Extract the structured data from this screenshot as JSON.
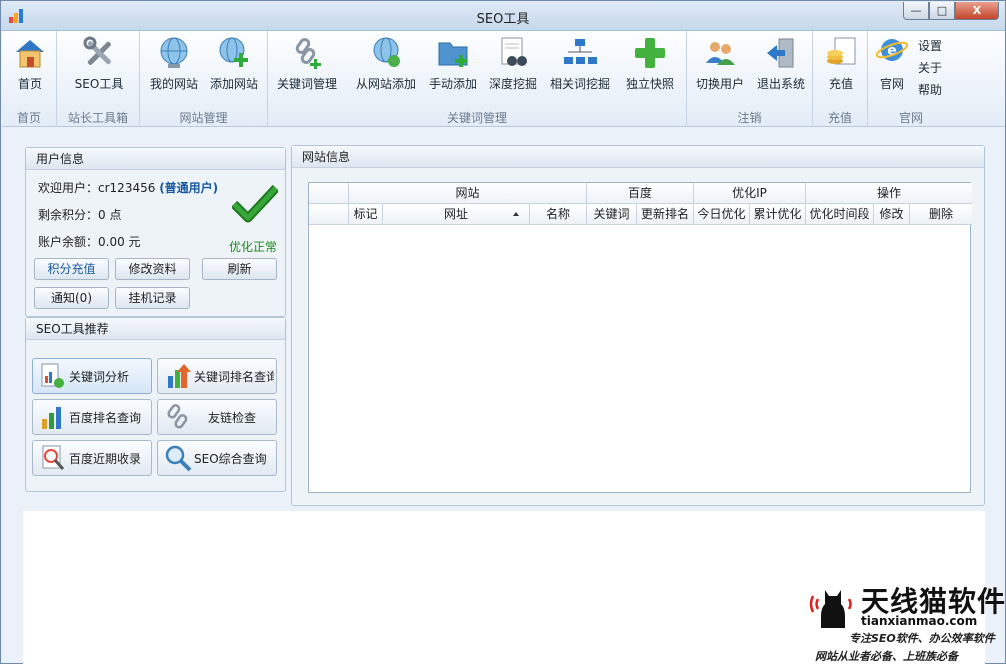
{
  "window": {
    "title": "SEO工具",
    "controls": {
      "minimize": "—",
      "maximize": "□",
      "close": "X"
    }
  },
  "ribbon": {
    "buttons": {
      "home": "首页",
      "seo_tool": "SEO工具",
      "my_site": "我的网站",
      "add_site": "添加网站",
      "keyword_manage": "关键词管理",
      "add_from_site": "从网站添加",
      "manual_add": "手动添加",
      "deep_mine": "深度挖掘",
      "related_mine": "相关词挖掘",
      "snapshot": "独立快照",
      "switch_user": "切换用户",
      "logout": "退出系统",
      "recharge": "充值",
      "official": "官网"
    },
    "links": {
      "settings": "设置",
      "about": "关于",
      "help": "帮助"
    },
    "groups": {
      "home": "首页",
      "toolbox": "站长工具箱",
      "site_manage": "网站管理",
      "keyword_manage": "关键词管理",
      "logout": "注销",
      "recharge": "充值",
      "official": "官网"
    }
  },
  "user_panel": {
    "title": "用户信息",
    "welcome_label": "欢迎用户：",
    "username": "cr123456",
    "user_type": "(普通用户)",
    "points": "剩余积分：0 点",
    "balance": "账户余额：0.00 元",
    "status": "优化正常",
    "buttons": {
      "recharge_points": "积分充值",
      "edit_profile": "修改资料",
      "refresh": "刷新",
      "notify": "通知(0)",
      "hang_log": "挂机记录"
    }
  },
  "tools_panel": {
    "title": "SEO工具推荐",
    "tools": [
      {
        "label": "关键词分析",
        "icon": "keyword-analysis-icon"
      },
      {
        "label": "关键词排名查询",
        "icon": "keyword-rank-icon"
      },
      {
        "label": "百度排名查询",
        "icon": "bar-chart-icon"
      },
      {
        "label": "友链检查",
        "icon": "link-chain-icon"
      },
      {
        "label": "百度近期收录",
        "icon": "index-check-icon"
      },
      {
        "label": "SEO综合查询",
        "icon": "magnifier-icon"
      }
    ]
  },
  "site_panel": {
    "title": "网站信息",
    "groups": {
      "site": "网站",
      "baidu": "百度",
      "opt_ip": "优化IP",
      "ops": "操作"
    },
    "columns": {
      "mark": "标记",
      "url": "网址",
      "name": "名称",
      "keyword": "关键词",
      "update_rank": "更新排名",
      "today_opt": "今日优化",
      "total_opt": "累计优化",
      "opt_period": "优化时间段",
      "edit": "修改",
      "delete": "删除"
    },
    "rows": []
  },
  "brand": {
    "name": "天线猫软件",
    "site": "tianxianmao.com",
    "slogan1": "专注SEO软件、办公效率软件",
    "slogan2": "网站从业者必备、上班族必备"
  },
  "colors": {
    "accent": "#1a5aa0",
    "ok": "#1a8a1a",
    "close": "#c4452b"
  }
}
